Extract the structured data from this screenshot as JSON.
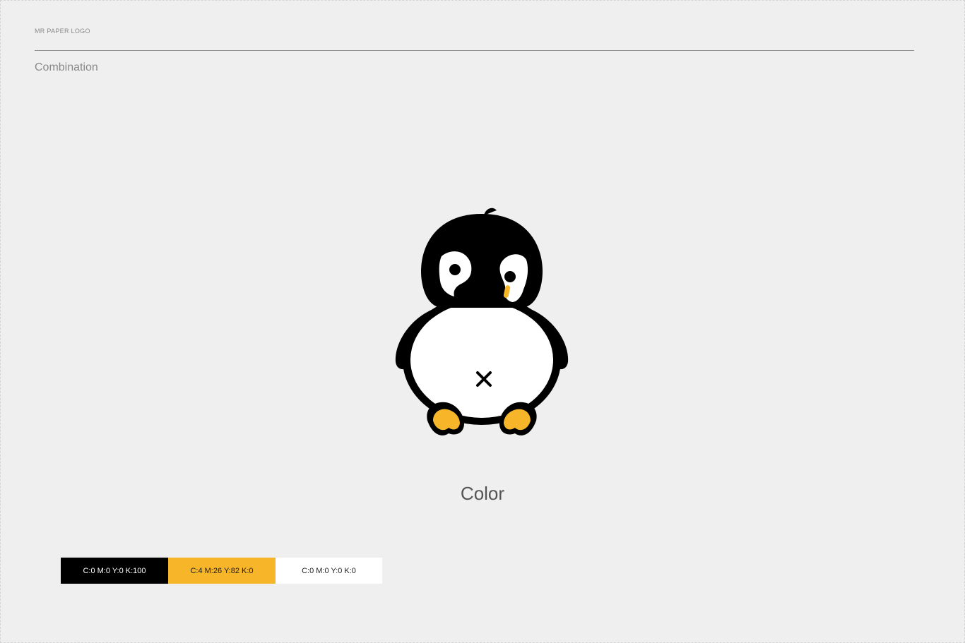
{
  "header": {
    "brand_label": "MR PAPER LOGO",
    "section_title": "Combination"
  },
  "logo": {
    "icon": "penguin-mascot",
    "colors": {
      "body": "#000000",
      "belly": "#ffffff",
      "accent": "#f7b52a"
    }
  },
  "color_section": {
    "title": "Color",
    "swatches": [
      {
        "label": "C:0 M:0 Y:0 K:100",
        "color": "#000000"
      },
      {
        "label": "C:4 M:26 Y:82 K:0",
        "color": "#f7b52a"
      },
      {
        "label": "C:0 M:0 Y:0 K:0",
        "color": "#ffffff"
      }
    ]
  }
}
